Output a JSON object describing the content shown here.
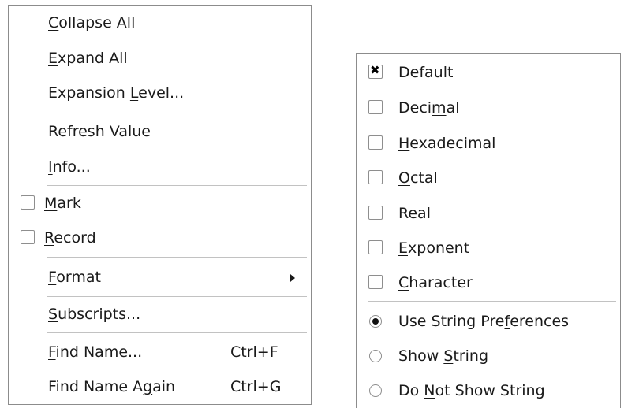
{
  "left_menu": {
    "items": [
      {
        "pre": "",
        "mn": "C",
        "post": "ollapse All"
      },
      {
        "pre": "",
        "mn": "E",
        "post": "xpand All"
      },
      {
        "pre": "Expansion ",
        "mn": "L",
        "post": "evel..."
      },
      {
        "pre": "Refresh ",
        "mn": "V",
        "post": "alue"
      },
      {
        "pre": "",
        "mn": "I",
        "post": "nfo..."
      },
      {
        "pre": "",
        "mn": "M",
        "post": "ark",
        "checked": false
      },
      {
        "pre": "",
        "mn": "R",
        "post": "ecord",
        "checked": false
      },
      {
        "pre": "",
        "mn": "F",
        "post": "ormat"
      },
      {
        "pre": "",
        "mn": "S",
        "post": "ubscripts..."
      },
      {
        "pre": "",
        "mn": "F",
        "post": "ind Name...",
        "shortcut": "Ctrl+F"
      },
      {
        "pre": "Find Name A",
        "mn": "g",
        "post": "ain",
        "shortcut": "Ctrl+G"
      }
    ]
  },
  "right_menu": {
    "items": [
      {
        "pre": "",
        "mn": "D",
        "post": "efault",
        "checked": true
      },
      {
        "pre": "Deci",
        "mn": "m",
        "post": "al",
        "checked": false
      },
      {
        "pre": "",
        "mn": "H",
        "post": "exadecimal",
        "checked": false
      },
      {
        "pre": "",
        "mn": "O",
        "post": "ctal",
        "checked": false
      },
      {
        "pre": "",
        "mn": "R",
        "post": "eal",
        "checked": false
      },
      {
        "pre": "",
        "mn": "E",
        "post": "xponent",
        "checked": false
      },
      {
        "pre": "",
        "mn": "C",
        "post": "haracter",
        "checked": false
      },
      {
        "pre": "Use String Pre",
        "mn": "f",
        "post": "erences",
        "selected": true
      },
      {
        "pre": "Show ",
        "mn": "S",
        "post": "tring",
        "selected": false
      },
      {
        "pre": "Do ",
        "mn": "N",
        "post": "ot Show String",
        "selected": false
      }
    ]
  }
}
